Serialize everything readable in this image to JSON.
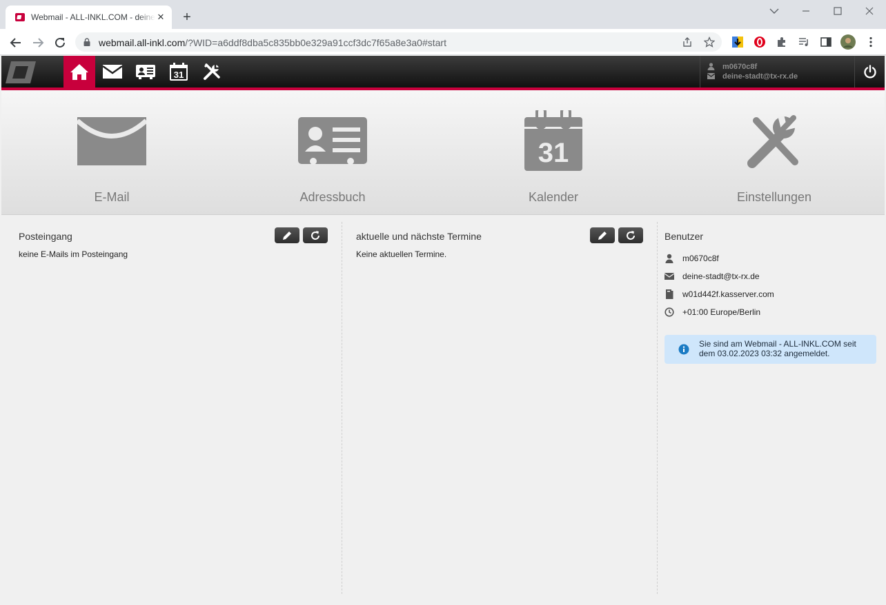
{
  "browser": {
    "tab_title": "Webmail - ALL-INKL.COM - deine-stadt@tx-rx.de",
    "tab_close": "✕",
    "new_tab": "+",
    "url_host": "webmail.all-inkl.com",
    "url_path": "/?WID=a6ddf8dba5c835bb0e329a91ccf3dc7f65a8e3a0#start",
    "window_controls": [
      "chevron-down",
      "minimize",
      "maximize",
      "close"
    ]
  },
  "header": {
    "nav": [
      "home",
      "email",
      "addressbook",
      "calendar",
      "settings"
    ],
    "calendar_day": "31",
    "user_name": "m0670c8f",
    "user_email": "deine-stadt@tx-rx.de"
  },
  "tiles": [
    {
      "label": "E-Mail",
      "icon": "envelope-icon"
    },
    {
      "label": "Adressbuch",
      "icon": "address-card-icon"
    },
    {
      "label": "Kalender",
      "icon": "calendar-icon",
      "day": "31"
    },
    {
      "label": "Einstellungen",
      "icon": "tools-icon"
    }
  ],
  "inbox": {
    "title": "Posteingang",
    "empty_text": "keine E-Mails im Posteingang"
  },
  "appointments": {
    "title": "aktuelle und nächste Termine",
    "empty_text": "Keine aktuellen Termine."
  },
  "user_panel": {
    "title": "Benutzer",
    "username": "m0670c8f",
    "email": "deine-stadt@tx-rx.de",
    "server": "w01d442f.kasserver.com",
    "timezone": "+01:00 Europe/Berlin",
    "info": "Sie sind am Webmail - ALL-INKL.COM seit dem 03.02.2023 03:32 angemeldet."
  },
  "colors": {
    "accent": "#c8003c",
    "header_dark": "#1a1a1a",
    "info_bg": "#cfe6fb",
    "icon_gray": "#8a8a8a"
  }
}
